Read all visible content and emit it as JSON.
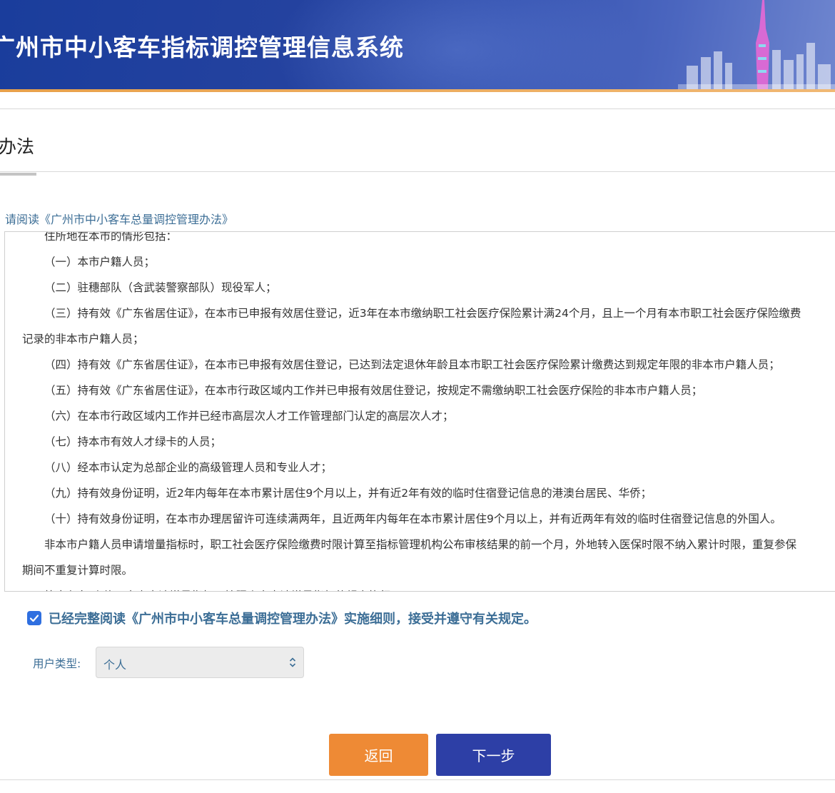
{
  "header": {
    "title": "广州市中小客车指标调控管理信息系统"
  },
  "section": {
    "title": "办法"
  },
  "reading": {
    "prompt": "请阅读《广州市中小客车总量调控管理办法》",
    "lines": [
      {
        "text": "住所地在本市的情形包括：",
        "indent": true
      },
      {
        "text": "（一）本市户籍人员；",
        "indent": true
      },
      {
        "text": "（二）驻穗部队（含武装警察部队）现役军人；",
        "indent": true
      },
      {
        "text": "（三）持有效《广东省居住证》，在本市已申报有效居住登记，近3年在本市缴纳职工社会医疗保险累计满24个月，且上一个月有本市职工社会医疗保险缴费",
        "indent": true
      },
      {
        "text": "记录的非本市户籍人员；",
        "indent": false
      },
      {
        "text": "（四）持有效《广东省居住证》，在本市已申报有效居住登记，已达到法定退休年龄且本市职工社会医疗保险累计缴费达到规定年限的非本市户籍人员；",
        "indent": true
      },
      {
        "text": "（五）持有效《广东省居住证》，在本市行政区域内工作并已申报有效居住登记，按规定不需缴纳职工社会医疗保险的非本市户籍人员；",
        "indent": true
      },
      {
        "text": "（六）在本市行政区域内工作并已经市高层次人才工作管理部门认定的高层次人才；",
        "indent": true
      },
      {
        "text": "（七）持本市有效人才绿卡的人员；",
        "indent": true
      },
      {
        "text": "（八）经本市认定为总部企业的高级管理人员和专业人才；",
        "indent": true
      },
      {
        "text": "（九）持有效身份证明，近2年内每年在本市累计居住9个月以上，并有近2年有效的临时住宿登记信息的港澳台居民、华侨；",
        "indent": true
      },
      {
        "text": "（十）持有效身份证明，在本市办理居留许可连续满两年，且近两年内每年在本市累计居住9个月以上，并有近两年有效的临时住宿登记信息的外国人。",
        "indent": true
      },
      {
        "text": "非本市户籍人员申请增量指标时，职工社会医疗保险缴费时限计算至指标管理机构公布审核结果的前一个月，外地转入医保时限不纳入累计时限，重复参保",
        "indent": true
      },
      {
        "text": "期间不重复计算时限。",
        "indent": false
      },
      {
        "text": "第十七条 个体工商户申请增量指标，按照个人申请增量指标的规定执行。",
        "indent": true
      }
    ]
  },
  "agreement": {
    "checked": true,
    "text": "已经完整阅读《广州市中小客车总量调控管理办法》实施细则，接受并遵守有关规定。"
  },
  "user_type": {
    "label": "用户类型:",
    "value": "个人"
  },
  "buttons": {
    "back": "返回",
    "next": "下一步"
  },
  "colors": {
    "header": "#24429f",
    "accent_bar": "#e8a04a",
    "link_text": "#3c6e96",
    "back_button": "#ee8a35",
    "next_button": "#2d3fa6",
    "checkbox": "#2f6fe0"
  }
}
